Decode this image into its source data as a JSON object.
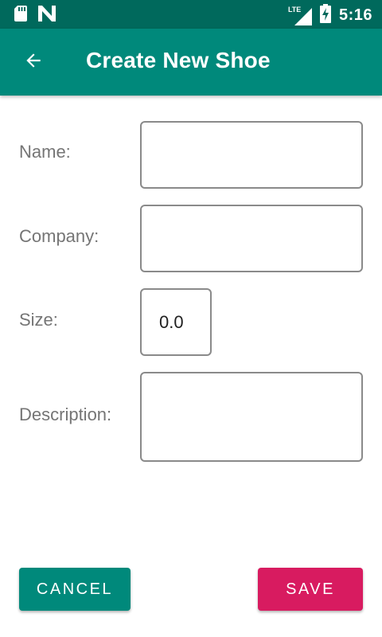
{
  "status_bar": {
    "time": "5:16",
    "network": "LTE",
    "icons": [
      "sd-card-icon",
      "n-logo-icon",
      "lte-signal-icon",
      "battery-charging-icon"
    ]
  },
  "app_bar": {
    "title": "Create New Shoe",
    "back_icon": "arrow-back-icon"
  },
  "form": {
    "name_label": "Name:",
    "name_value": "",
    "company_label": "Company:",
    "company_value": "",
    "size_label": "Size:",
    "size_value": "0.0",
    "description_label": "Description:",
    "description_value": ""
  },
  "actions": {
    "cancel_label": "Cancel",
    "save_label": "Save"
  },
  "colors": {
    "status_bar": "#00695c",
    "app_bar": "#00897b",
    "cancel_button": "#00897b",
    "save_button": "#d81b60",
    "label_text": "#757575",
    "field_border": "#8a8a8a"
  }
}
